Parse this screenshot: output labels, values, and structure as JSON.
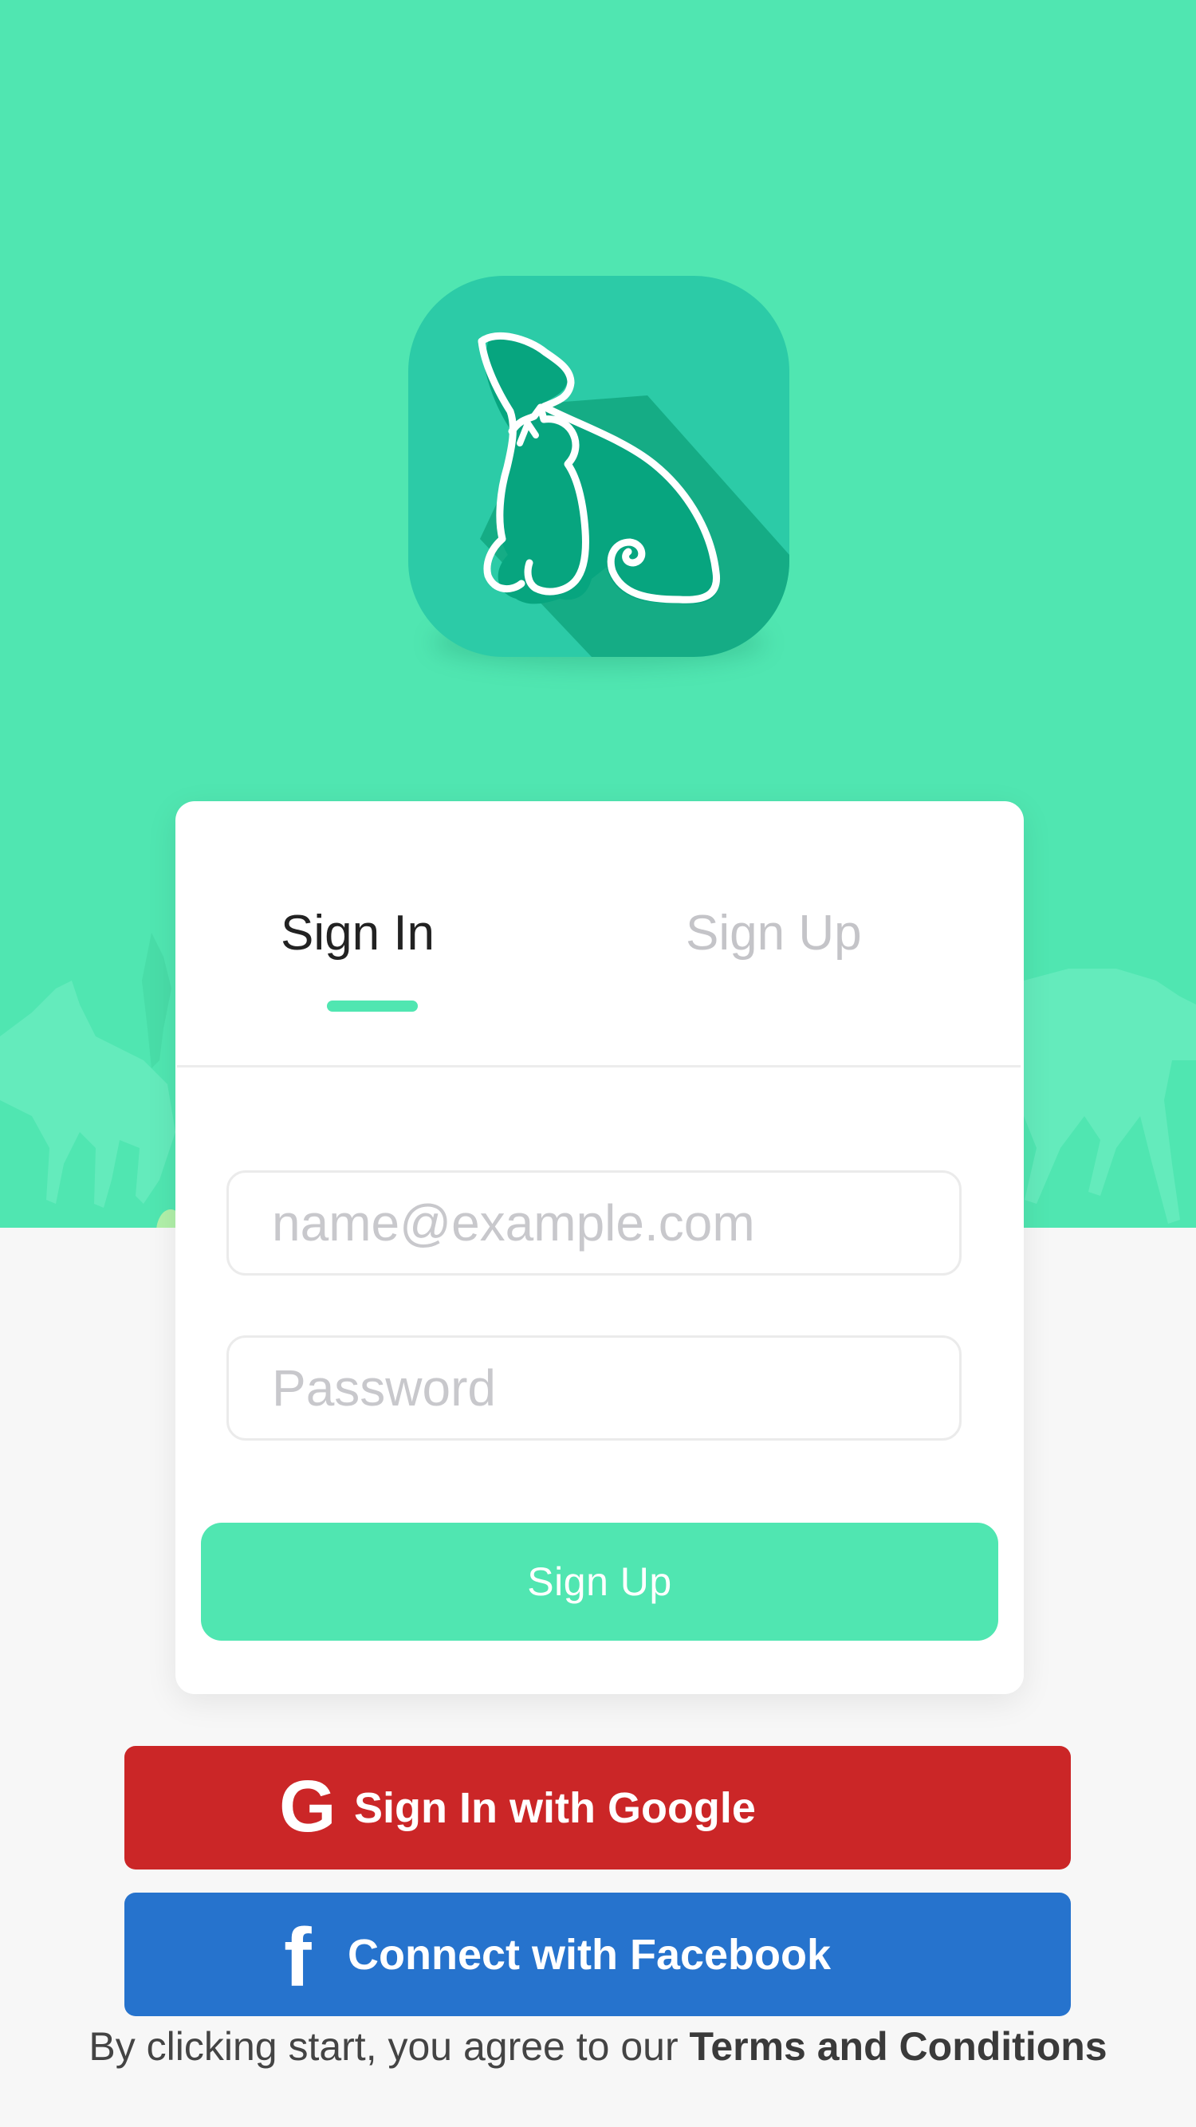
{
  "colors": {
    "brand_green": "#50e6b1",
    "google_red": "#cb2627",
    "facebook_blue": "#2673cd",
    "page_background": "#f7f7f7"
  },
  "logo": {
    "icon": "dog-and-cat-icon"
  },
  "auth_card": {
    "tabs": [
      {
        "label": "Sign In",
        "active": true
      },
      {
        "label": "Sign Up",
        "active": false
      }
    ],
    "email": {
      "placeholder": "name@example.com",
      "value": ""
    },
    "password": {
      "placeholder": "Password",
      "value": ""
    },
    "submit_label": "Sign Up"
  },
  "social": {
    "google": {
      "label": "Sign In with Google",
      "icon": "google-g-icon",
      "icon_glyph": "G"
    },
    "facebook": {
      "label": "Connect with Facebook",
      "icon": "facebook-f-icon",
      "icon_glyph": "f"
    }
  },
  "terms": {
    "prefix": "By clicking start, you agree to our ",
    "link": "Terms and Conditions"
  }
}
